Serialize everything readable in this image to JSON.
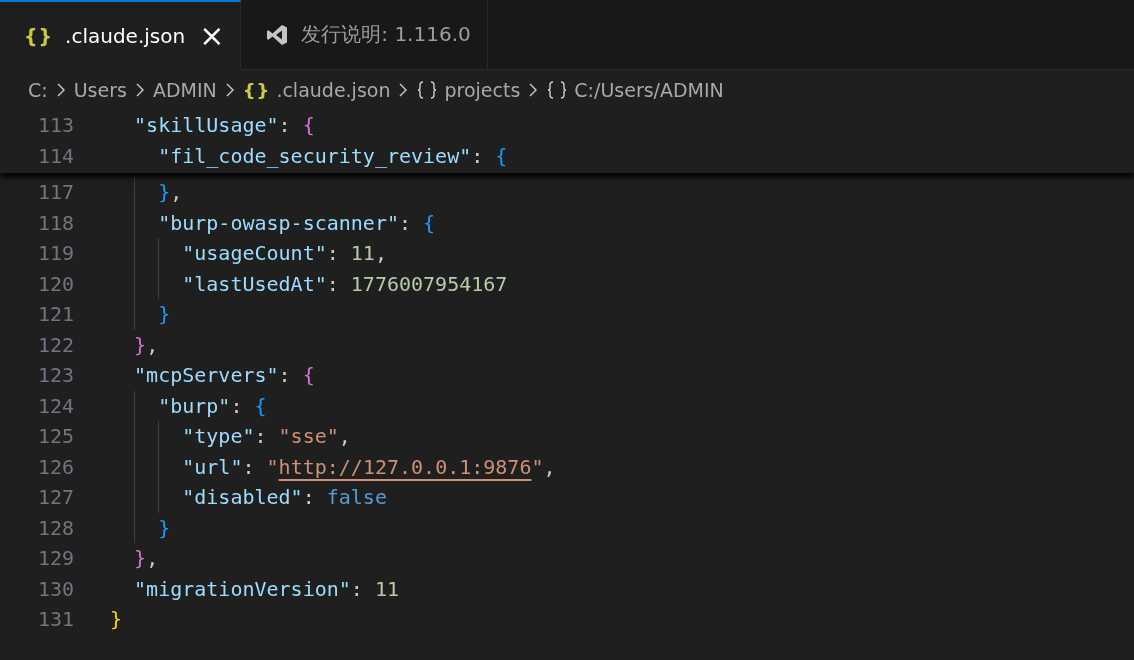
{
  "tabs": [
    {
      "label": ".claude.json",
      "kind": "json",
      "glyph": "{}",
      "selected": true,
      "close": "×"
    },
    {
      "label": "发行说明: 1.116.0",
      "kind": "release-notes",
      "selected": false
    }
  ],
  "breadcrumbs": [
    {
      "label": "C:",
      "kind": "folder"
    },
    {
      "label": "Users",
      "kind": "folder"
    },
    {
      "label": "ADMIN",
      "kind": "folder"
    },
    {
      "label": ".claude.json",
      "kind": "json",
      "glyph": "{}"
    },
    {
      "label": "projects",
      "kind": "object"
    },
    {
      "label": "C:/Users/ADMIN",
      "kind": "object"
    }
  ],
  "sticky_lines": [
    [
      {
        "number": "113",
        "tokens": [
          {
            "kind": "key",
            "text": "\"skillUsage\""
          },
          {
            "kind": "punct",
            "text": ": "
          },
          {
            "kind": "brace",
            "text": "{",
            "color": "#da70d6"
          }
        ]
      },
      [
        {
          "number": "114",
          "tokens": [
            {
              "kind": "key",
              "text": "\"fil_code_security_review\""
            },
            {
              "kind": "punct",
              "text": ": "
            },
            {
              "kind": "brace",
              "text": "{",
              "color": "#179fff"
            }
          ]
        }
      ]
    ]
  ],
  "lines": [
    [
      [
        {
          "number": "117",
          "tokens": [
            {
              "kind": "brace",
              "text": "}",
              "color": "#179fff"
            },
            {
              "kind": "punct",
              "text": ","
            }
          ]
        },
        {
          "number": "118",
          "tokens": [
            {
              "kind": "key",
              "text": "\"burp-owasp-scanner\""
            },
            {
              "kind": "punct",
              "text": ": "
            },
            {
              "kind": "brace",
              "text": "{",
              "color": "#179fff"
            }
          ]
        },
        [
          {
            "number": "119",
            "tokens": [
              {
                "kind": "key",
                "text": "\"usageCount\""
              },
              {
                "kind": "punct",
                "text": ": "
              },
              {
                "kind": "number",
                "text": "11"
              },
              {
                "kind": "punct",
                "text": ","
              }
            ]
          },
          {
            "number": "120",
            "tokens": [
              {
                "kind": "key",
                "text": "\"lastUsedAt\""
              },
              {
                "kind": "punct",
                "text": ": "
              },
              {
                "kind": "number",
                "text": "1776007954167"
              }
            ]
          }
        ],
        {
          "number": "121",
          "tokens": [
            {
              "kind": "brace",
              "text": "}",
              "color": "#179fff"
            }
          ]
        }
      ],
      {
        "number": "122",
        "tokens": [
          {
            "kind": "brace",
            "text": "}",
            "color": "#da70d6"
          },
          {
            "kind": "punct",
            "text": ","
          }
        ]
      },
      {
        "number": "123",
        "tokens": [
          {
            "kind": "key",
            "text": "\"mcpServers\""
          },
          {
            "kind": "punct",
            "text": ": "
          },
          {
            "kind": "brace",
            "text": "{",
            "color": "#da70d6"
          }
        ]
      },
      [
        {
          "number": "124",
          "tokens": [
            {
              "kind": "key",
              "text": "\"burp\""
            },
            {
              "kind": "punct",
              "text": ": "
            },
            {
              "kind": "brace",
              "text": "{",
              "color": "#179fff"
            }
          ]
        },
        [
          {
            "number": "125",
            "tokens": [
              {
                "kind": "key",
                "text": "\"type\""
              },
              {
                "kind": "punct",
                "text": ": "
              },
              {
                "kind": "string",
                "text": "\"sse\""
              },
              {
                "kind": "punct",
                "text": ","
              }
            ]
          },
          {
            "number": "126",
            "tokens": [
              {
                "kind": "key",
                "text": "\"url\""
              },
              {
                "kind": "punct",
                "text": ": "
              },
              {
                "kind": "string",
                "text": "\""
              },
              {
                "kind": "link",
                "text": "http://127.0.0.1:9876"
              },
              {
                "kind": "string",
                "text": "\""
              },
              {
                "kind": "punct",
                "text": ","
              }
            ]
          },
          {
            "number": "127",
            "tokens": [
              {
                "kind": "key",
                "text": "\"disabled\""
              },
              {
                "kind": "punct",
                "text": ": "
              },
              {
                "kind": "keyword",
                "text": "false"
              }
            ]
          }
        ],
        {
          "number": "128",
          "tokens": [
            {
              "kind": "brace",
              "text": "}",
              "color": "#179fff"
            }
          ]
        }
      ],
      {
        "number": "129",
        "tokens": [
          {
            "kind": "brace",
            "text": "}",
            "color": "#da70d6"
          },
          {
            "kind": "punct",
            "text": ","
          }
        ]
      },
      {
        "number": "130",
        "tokens": [
          {
            "kind": "key",
            "text": "\"migrationVersion\""
          },
          {
            "kind": "punct",
            "text": ": "
          },
          {
            "kind": "number",
            "text": "11"
          }
        ]
      }
    ],
    {
      "number": "131",
      "tokens": [
        {
          "kind": "brace",
          "text": "}",
          "color": "#ffd700"
        }
      ]
    }
  ]
}
